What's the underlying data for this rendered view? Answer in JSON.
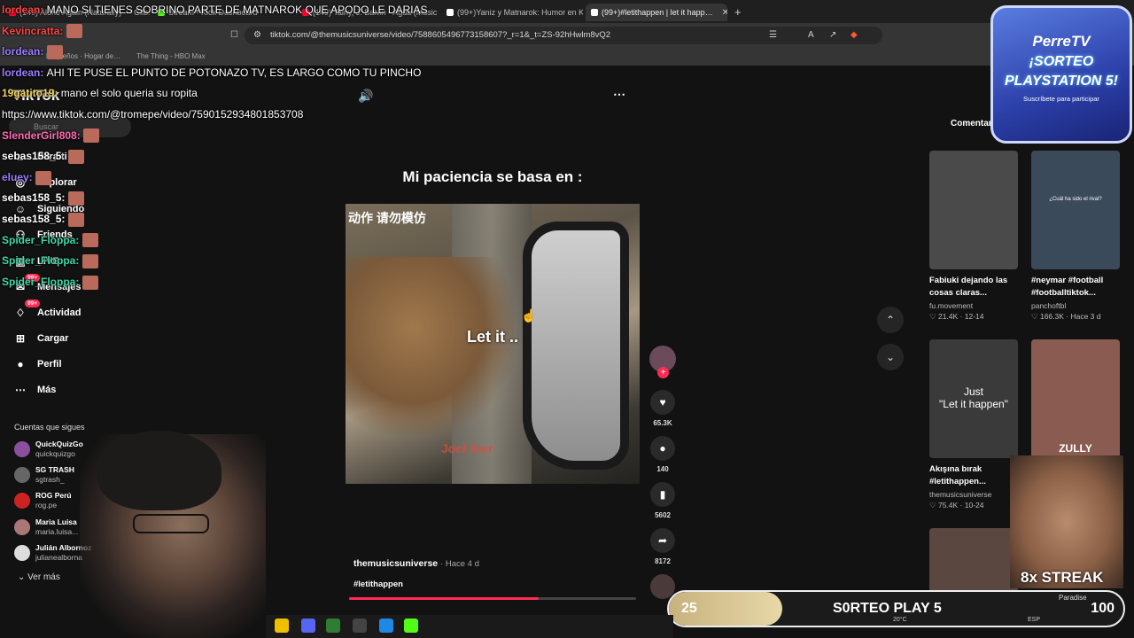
{
  "browser": {
    "tabs": [
      {
        "title": "(149) Alone Again (Naturally) — Gilb…",
        "color": "#ff0033"
      },
      {
        "title": "Stream - Kick Dashboard",
        "color": "#53fc18"
      },
      {
        "title": "(149) Tainy, J. Balvin - Agua (Music Fr…",
        "color": "#ff0033"
      },
      {
        "title": "(99+)Yaniz y Matnarok: Humor en Ki…",
        "color": "#ffffff"
      },
      {
        "title": "(99+)#letithappen | let it happ…",
        "color": "#ffffff",
        "active": true
      }
    ],
    "new_tab": "+",
    "url": "tiktok.com/@themusicsuniverse/video/7588605496773158607?_r=1&_t=ZS-92hHwlm8vQ2",
    "bookmarks": [
      "Pequeños · Hogar de…",
      "The Thing - HBO Max"
    ]
  },
  "tiktok": {
    "logo": "TikTok",
    "search_placeholder": "Buscar",
    "nav": [
      {
        "label": "Para ti",
        "icon": "home-icon"
      },
      {
        "label": "Explorar",
        "icon": "compass-icon"
      },
      {
        "label": "Siguiendo",
        "icon": "following-icon"
      },
      {
        "label": "Friends",
        "icon": "friends-icon"
      },
      {
        "label": "LIVE",
        "icon": "live-icon"
      },
      {
        "label": "Mensajes",
        "icon": "message-icon",
        "badge": "99+"
      },
      {
        "label": "Actividad",
        "icon": "activity-icon",
        "badge": "99+"
      },
      {
        "label": "Cargar",
        "icon": "upload-icon"
      },
      {
        "label": "Perfil",
        "icon": "profile-icon"
      },
      {
        "label": "Más",
        "icon": "more-icon"
      }
    ],
    "following_title": "Cuentas que sigues",
    "following": [
      {
        "name": "QuickQuizGo",
        "handle": "quickquizgo"
      },
      {
        "name": "SG TRASH",
        "handle": "sgtrash_"
      },
      {
        "name": "ROG Perú",
        "handle": "rog.pe"
      },
      {
        "name": "Maria Luisa",
        "handle": "maria.luisa..."
      },
      {
        "name": "Julián Albornoz",
        "handle": "julianealborna"
      }
    ],
    "see_more": "Ver más",
    "video": {
      "caption": "Mi paciencia se basa en :",
      "overlay_chinese": "动作 请勿模仿",
      "subtitle": "Let it ..",
      "subtitle2": "Joel Sier",
      "author": "themusicsuniverse",
      "time_ago": "· Hace 4 d",
      "hashtag": "#letithappen",
      "progress": 0.66
    },
    "actions": [
      {
        "name": "like",
        "icon": "♥",
        "count": "65.3K"
      },
      {
        "name": "comment",
        "icon": "●",
        "count": "140"
      },
      {
        "name": "bookmark",
        "icon": "▮",
        "count": "5602"
      },
      {
        "name": "share",
        "icon": "➦",
        "count": "8172"
      }
    ],
    "right_tab": "Comentarios",
    "thumbs": [
      {
        "title": "Fabiuki dejando las cosas claras...",
        "author": "fu.movement",
        "stats": "♡ 21.4K · 12-14",
        "bg": "#4a4a4a"
      },
      {
        "title": "#neymar #football #footballtiktok...",
        "author": "panchoftbl",
        "stats": "♡ 166.3K · Hace 3 d",
        "bg": "#3b4a5a",
        "overlay": "¿Cuál ha sido el rival?"
      },
      {
        "title": "Akışına bırak #letithappen...",
        "author": "themusicsuniverse",
        "stats": "♡ 75.4K · 10-24",
        "bg": "#3a3a3a",
        "overlay": "Just\n\"Let it happen\""
      },
      {
        "title": "",
        "author": "",
        "stats": "",
        "bg": "#8a5b50",
        "overlay": "ZULLY"
      }
    ]
  },
  "chat": [
    {
      "user": "lordean",
      "color": "#ff4444",
      "msg": "MANO SI TIENES SOBRINO PARTE DE MATNAROK QUE APODO LE DARIAS"
    },
    {
      "user": "Kevincratta",
      "color": "#ff4444",
      "msg": "",
      "emote": true
    },
    {
      "user": "lordean",
      "color": "#9a7dff",
      "msg": "",
      "emote": true
    },
    {
      "user": "lordean",
      "color": "#9a7dff",
      "msg": "AHI TE PUSE EL PUNTO DE POTONAZO TV, ES LARGO COMO TU PINCHO"
    },
    {
      "user": "19gatito19",
      "color": "#f2d45c",
      "msg": "mano el solo queria su ropita"
    },
    {
      "user": "",
      "color": "#ffffff",
      "msg": "https://www.tiktok.com/@tromepe/video/7590152934801853708"
    },
    {
      "user": "SlenderGirl808",
      "color": "#ff6bb5",
      "msg": "",
      "emote": true
    },
    {
      "user": "sebas158_5",
      "color": "#ffffff",
      "msg": "",
      "emote": true
    },
    {
      "user": "eluey",
      "color": "#9a7dff",
      "msg": "",
      "emote": true
    },
    {
      "user": "sebas158_5",
      "color": "#ffffff",
      "msg": "",
      "emote": true
    },
    {
      "user": "sebas158_5",
      "color": "#ffffff",
      "msg": "",
      "emote": true
    },
    {
      "user": "Spider_Floppa",
      "color": "#3fd9a8",
      "msg": "",
      "emote": true
    },
    {
      "user": "Spider_Floppa",
      "color": "#3fd9a8",
      "msg": "",
      "emote": true
    },
    {
      "user": "Spider_Floppa",
      "color": "#3fd9a8",
      "msg": "",
      "emote": true
    }
  ],
  "overlay": {
    "promo_brand": "PerreTV",
    "promo_line1": "¡SORTEO",
    "promo_line2": "PLAYSTATION 5!",
    "promo_small": "Suscríbete para participar",
    "streak": "8x STREAK",
    "goal_current": "25",
    "goal_label": "S0RTEO PLAY 5",
    "goal_target": "100",
    "goal_fraction": 0.25,
    "goal_note": "Paradise"
  },
  "system": {
    "lang": "ESP",
    "weather": "20°C"
  }
}
